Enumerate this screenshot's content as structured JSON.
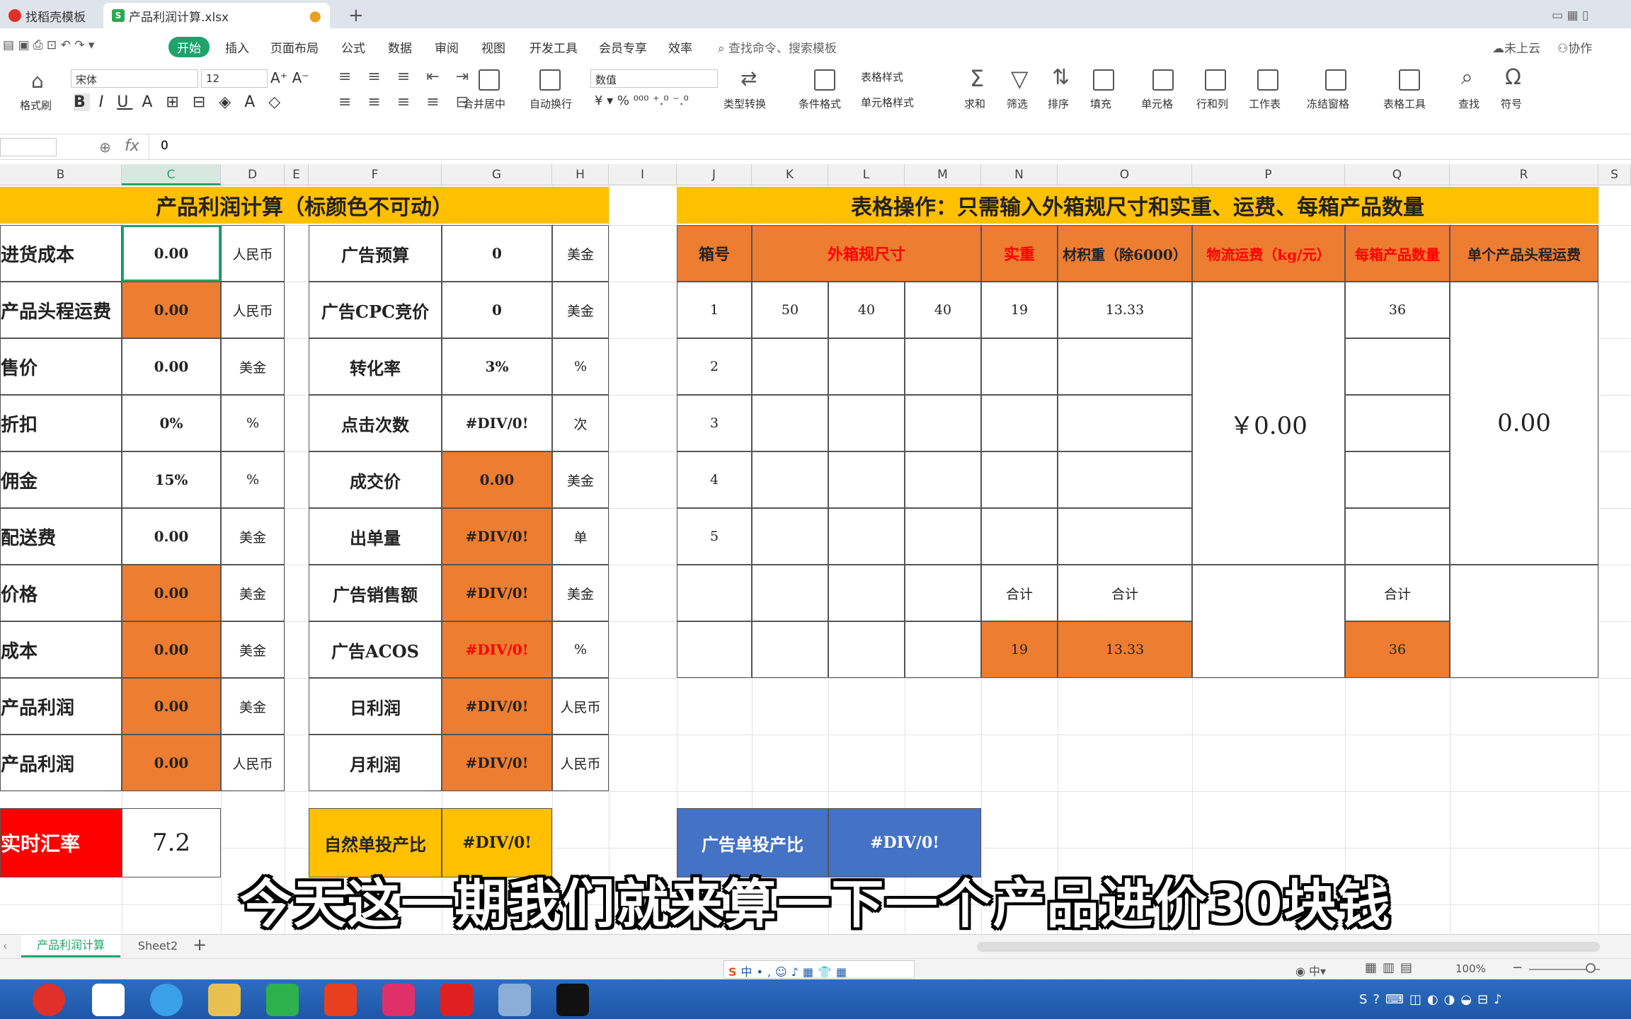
{
  "tabs": [
    {
      "label": "找稻壳模板"
    },
    {
      "label": "产品利润计算.xlsx"
    }
  ],
  "menu": [
    "开始",
    "插入",
    "页面布局",
    "公式",
    "数据",
    "审阅",
    "视图",
    "开发工具",
    "会员专享",
    "效率"
  ],
  "search_placeholder": "查找命令、搜索模板",
  "right_menu": [
    "未上云",
    "协作"
  ],
  "ribbon": {
    "font": "宋体",
    "size": "12",
    "format": "数值",
    "fmt_painter": "格式刷",
    "merge": "合并居中",
    "wrap": "自动换行",
    "type_convert": "类型转换",
    "cond_fmt": "条件格式",
    "table_style": "表格样式",
    "cell_style": "单元格样式",
    "sum": "求和",
    "filter": "筛选",
    "sort": "排序",
    "fill": "填充",
    "cell": "单元格",
    "rowcol": "行和列",
    "sheet": "工作表",
    "freeze": "冻结窗格",
    "tools": "表格工具",
    "find": "查找",
    "symbol": "符号"
  },
  "formula": {
    "fx": "fx",
    "value": "0"
  },
  "columns": [
    "B",
    "C",
    "D",
    "E",
    "F",
    "G",
    "H",
    "I",
    "J",
    "K",
    "L",
    "M",
    "N",
    "O",
    "P",
    "Q",
    "R"
  ],
  "left_title": "产品利润计算（标颜色不可动）",
  "right_title": "表格操作：只需输入外箱规尺寸和实重、运费、每箱产品数量",
  "left_rows": [
    {
      "label": "进货成本",
      "value": "0.00",
      "unit": "人民币"
    },
    {
      "label": "产品头程运费",
      "value": "0.00",
      "unit": "人民币"
    },
    {
      "label": "售价",
      "value": "0.00",
      "unit": "美金"
    },
    {
      "label": "折扣",
      "value": "0%",
      "unit": "%"
    },
    {
      "label": "佣金",
      "value": "15%",
      "unit": "%"
    },
    {
      "label": "配送费",
      "value": "0.00",
      "unit": "美金"
    },
    {
      "label": "价格",
      "value": "0.00",
      "unit": "美金"
    },
    {
      "label": "成本",
      "value": "0.00",
      "unit": "美金"
    },
    {
      "label": "产品利润",
      "value": "0.00",
      "unit": "美金"
    },
    {
      "label": "产品利润",
      "value": "0.00",
      "unit": "人民币"
    }
  ],
  "mid_rows": [
    {
      "label": "广告预算",
      "value": "0",
      "unit": "美金"
    },
    {
      "label": "广告CPC竞价",
      "value": "0",
      "unit": "美金"
    },
    {
      "label": "转化率",
      "value": "3%",
      "unit": "%"
    },
    {
      "label": "点击次数",
      "value": "#DIV/0!",
      "unit": "次"
    },
    {
      "label": "成交价",
      "value": "0.00",
      "unit": "美金"
    },
    {
      "label": "出单量",
      "value": "#DIV/0!",
      "unit": "单"
    },
    {
      "label": "广告销售额",
      "value": "#DIV/0!",
      "unit": "美金"
    },
    {
      "label": "广告ACOS",
      "value": "#DIV/0!",
      "unit": "%"
    },
    {
      "label": "日利润",
      "value": "#DIV/0!",
      "unit": "人民币"
    },
    {
      "label": "月利润",
      "value": "#DIV/0!",
      "unit": "人民币"
    }
  ],
  "exchange": {
    "label": "实时汇率",
    "value": "7.2"
  },
  "natural_ratio": {
    "label": "自然单投产比",
    "value": "#DIV/0!"
  },
  "ad_ratio": {
    "label": "广告单投产比",
    "value": "#DIV/0!"
  },
  "right_headers": [
    "箱号",
    "外箱规尺寸",
    "实重",
    "材积重（除6000）",
    "物流运费（kg/元）",
    "每箱产品数量",
    "单个产品头程运费"
  ],
  "box_rows": [
    {
      "no": "1",
      "l": "50",
      "w": "40",
      "h": "40",
      "weight": "19",
      "vol": "13.33",
      "qty": "36"
    },
    {
      "no": "2",
      "l": "",
      "w": "",
      "h": "",
      "weight": "",
      "vol": "",
      "qty": ""
    },
    {
      "no": "3",
      "l": "",
      "w": "",
      "h": "",
      "weight": "",
      "vol": "",
      "qty": ""
    },
    {
      "no": "4",
      "l": "",
      "w": "",
      "h": "",
      "weight": "",
      "vol": "",
      "qty": ""
    },
    {
      "no": "5",
      "l": "",
      "w": "",
      "h": "",
      "weight": "",
      "vol": "",
      "qty": ""
    }
  ],
  "freight_total": "￥0.00",
  "unit_freight": "0.00",
  "sum_label": "合计",
  "totals": {
    "weight": "19",
    "vol": "13.33",
    "qty": "36"
  },
  "subtitle": "今天这一期我们就来算一下一个产品进价30块钱",
  "sheets": [
    "产品利润计算",
    "Sheet2"
  ],
  "zoom": "100%"
}
